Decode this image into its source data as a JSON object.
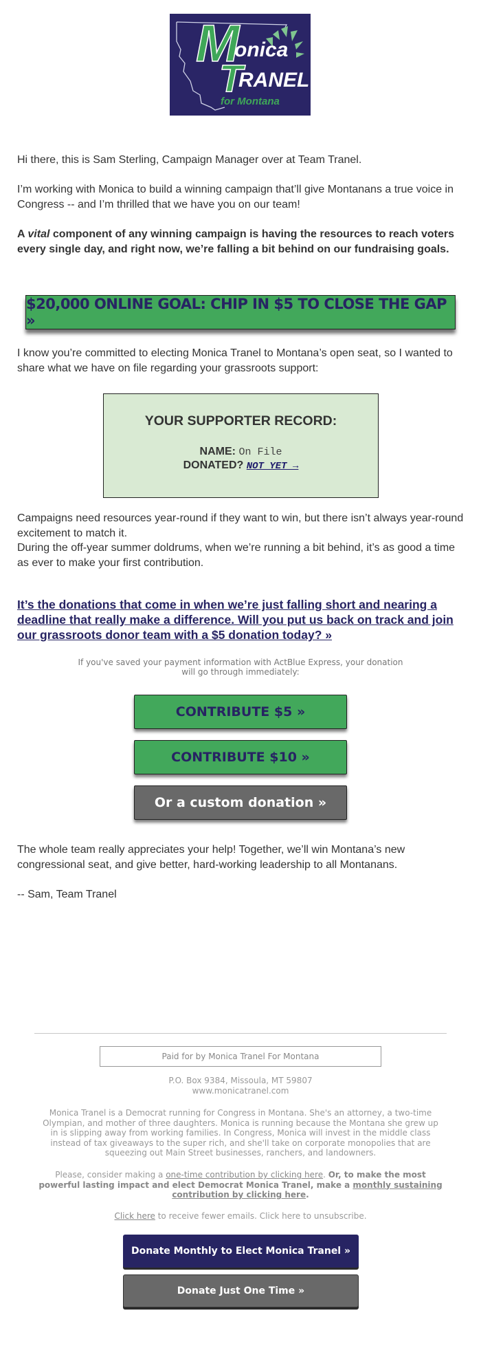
{
  "logo": {
    "m": "M",
    "onica": "onica",
    "t": "T",
    "ranel": "RANEL",
    "for_montana": "for Montana",
    "colors": {
      "background": "#2a2566",
      "green": "#3fa758",
      "white": "#ffffff"
    }
  },
  "intro": {
    "p1": "Hi there, this is Sam Sterling, Campaign Manager over at Team Tranel.",
    "p2": "I’m working with Monica to build a winning campaign that’ll give Montanans a true voice in Congress -- and I’m thrilled that we have you on our team!",
    "p3_prefix": "A ",
    "p3_vital": "vital",
    "p3_rest": " component of any winning campaign is having the resources to reach voters every single day, and right now, we’re falling a bit behind on our fundraising goals."
  },
  "goal_button": {
    "label": "$20,000 ONLINE GOAL: CHIP IN $5 TO CLOSE THE GAP »"
  },
  "p_committed": "I know you’re committed to electing Monica Tranel to Montana’s open seat, so I wanted to share what we have on file regarding your grassroots support:",
  "record": {
    "title": "YOUR SUPPORTER RECORD:",
    "name_label": "NAME:",
    "name_value": "On File",
    "donated_label": "DONATED?",
    "donated_value": "NOT YET →"
  },
  "p_campaigns": "Campaigns need resources year-round if they want to win, but there isn’t always year-round excitement to match it.",
  "p_doldrums": "During the off-year summer doldrums, when we’re running a bit behind, it’s as good a time as ever to make your first contribution.",
  "big_link": "It’s the donations that come in when we’re just falling short and nearing a deadline that really make a difference. Will you put us back on track and join our grassroots donor team with a $5 donation today? »",
  "express_note": "If you've saved your payment information with ActBlue Express, your donation will go through immediately:",
  "buttons": {
    "contribute5": "CONTRIBUTE $5 »",
    "contribute10": "CONTRIBUTE $10 »",
    "custom": "Or a custom donation »"
  },
  "closing": {
    "p1": "The whole team really appreciates your help! Together, we’ll win Montana’s new congressional seat, and give better, hard-working leadership to all Montanans.",
    "signature": "-- Sam, Team Tranel"
  },
  "footer": {
    "paid_for": "Paid for by Monica Tranel For Montana",
    "address": "P.O. Box 9384, Missoula, MT 59807",
    "website": "www.monicatranel.com",
    "bio": "Monica Tranel is a Democrat running for Congress in Montana. She's an attorney, a two-time Olympian, and mother of three daughters. Monica is running because the Montana she grew up in is slipping away from working families. In Congress, Monica will invest in the middle class instead of tax giveaways to the super rich, and she'll take on corporate monopolies that are squeezing out Main Street businesses, ranchers, and landowners.",
    "consider_prefix": "Please, consider making a ",
    "one_time_link": "one-time contribution by clicking here",
    "consider_mid": ". ",
    "bold_text": "Or, to make the most powerful lasting impact and elect Democrat Monica Tranel, make a ",
    "monthly_link": "monthly sustaining contribution by clicking here",
    "period": ".",
    "fewer_link": "Click here",
    "fewer_rest": " to receive fewer emails. Click here to unsubscribe.",
    "donate_monthly": "Donate Monthly to Elect Monica Tranel »",
    "donate_once": "Donate Just One Time »"
  },
  "colors": {
    "green_button": "#42a85b",
    "navy": "#272463",
    "gray_button": "#696969",
    "record_bg": "#d9ead3"
  }
}
